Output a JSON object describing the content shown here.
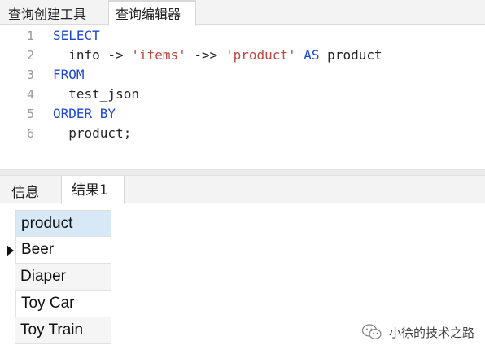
{
  "top_tabs": [
    {
      "label": "查询创建工具",
      "active": false
    },
    {
      "label": "查询编辑器",
      "active": true
    }
  ],
  "editor": {
    "lines": [
      {
        "number": "1",
        "tokens": [
          {
            "text": "SELECT",
            "kind": "kw"
          }
        ]
      },
      {
        "number": "2",
        "tokens": [
          {
            "text": "  info -> ",
            "kind": "plain"
          },
          {
            "text": "'items'",
            "kind": "str"
          },
          {
            "text": " ->> ",
            "kind": "plain"
          },
          {
            "text": "'product'",
            "kind": "str"
          },
          {
            "text": " ",
            "kind": "plain"
          },
          {
            "text": "AS",
            "kind": "kw"
          },
          {
            "text": " product",
            "kind": "plain"
          }
        ]
      },
      {
        "number": "3",
        "tokens": [
          {
            "text": "FROM",
            "kind": "kw"
          }
        ]
      },
      {
        "number": "4",
        "tokens": [
          {
            "text": "  test_json",
            "kind": "plain"
          }
        ]
      },
      {
        "number": "5",
        "tokens": [
          {
            "text": "ORDER BY",
            "kind": "kw"
          }
        ]
      },
      {
        "number": "6",
        "tokens": [
          {
            "text": "  product;",
            "kind": "plain"
          }
        ]
      }
    ],
    "colors": {
      "keyword": "#1d48d6",
      "string": "#c1463d",
      "line_number": "#999999"
    }
  },
  "bottom_tabs": [
    {
      "label": "信息",
      "active": false
    },
    {
      "label": "结果1",
      "active": true
    }
  ],
  "result": {
    "columns": [
      "product"
    ],
    "rows": [
      [
        "Beer"
      ],
      [
        "Diaper"
      ],
      [
        "Toy Car"
      ],
      [
        "Toy Train"
      ]
    ],
    "current_row": 0,
    "header_color": "#d7e8f6"
  },
  "watermark": {
    "text": "小徐的技术之路",
    "icon": "wechat-icon"
  }
}
